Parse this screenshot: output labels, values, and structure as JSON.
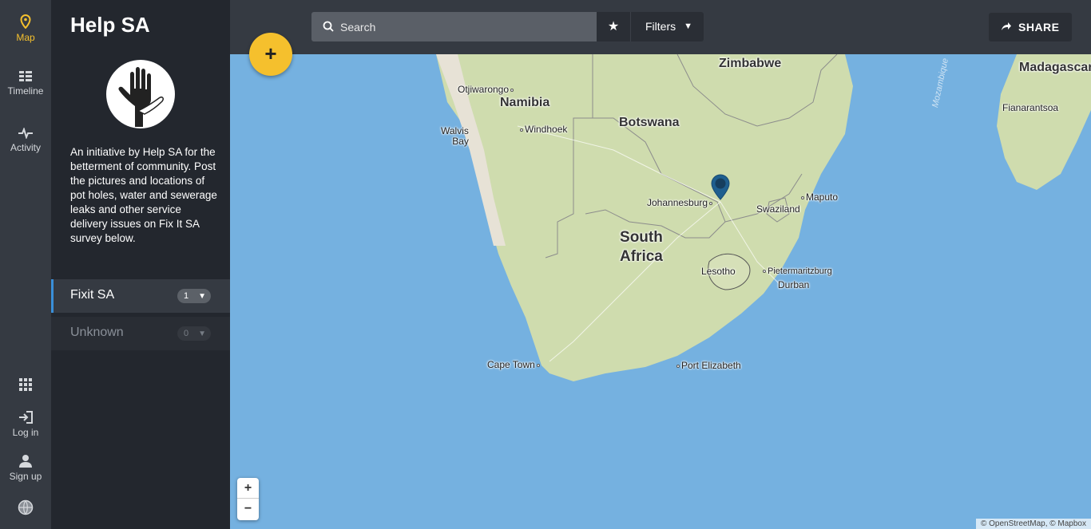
{
  "rail": {
    "map_label": "Map",
    "timeline_label": "Timeline",
    "activity_label": "Activity",
    "login_label": "Log in",
    "signup_label": "Sign up"
  },
  "panel": {
    "title": "Help SA",
    "description": "An initiative by Help SA for the betterment of community. Post the pictures and locations of pot holes, water and sewerage leaks and other service delivery issues on Fix It SA survey below.",
    "sets": [
      {
        "name": "Fixit SA",
        "count": "1"
      },
      {
        "name": "Unknown",
        "count": "0"
      }
    ]
  },
  "topbar": {
    "search_placeholder": "Search",
    "filters_label": "Filters",
    "share_label": "SHARE"
  },
  "map": {
    "add_label": "+",
    "zoom_in": "+",
    "zoom_out": "−",
    "attribution": "© OpenStreetMap, © Mapbox",
    "ocean_label": "Mozambique",
    "places": {
      "zimbabwe": "Zimbabwe",
      "madagascar": "Madagascar",
      "otjiwarongo": "Otjiwarongo",
      "namibia": "Namibia",
      "botswana": "Botswana",
      "fianarantsoa": "Fianarantsoa",
      "walvis1": "Walvis",
      "walvis2": "Bay",
      "windhoek": "Windhoek",
      "maputo": "Maputo",
      "johannesburg": "Johannesburg",
      "swaziland": "Swaziland",
      "south": "South",
      "africa": "Africa",
      "lesotho": "Lesotho",
      "pietermaritzburg": "Pietermaritzburg",
      "durban": "Durban",
      "capetown": "Cape Town",
      "portelizabeth": "Port Elizabeth"
    }
  },
  "colors": {
    "accent": "#f5c02d",
    "active_set_border": "#3a8fd9",
    "ocean": "#75b1e0",
    "land": "#cfdcae",
    "marker": "#1f5f8f"
  }
}
